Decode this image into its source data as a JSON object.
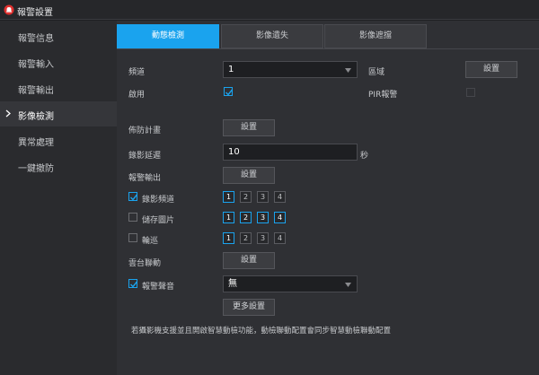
{
  "window": {
    "title": "報警設置",
    "accent": "#1aa3ee",
    "icon": "alarm-bell-icon"
  },
  "sidebar": {
    "items": [
      {
        "label": "報警信息",
        "active": false
      },
      {
        "label": "報警輸入",
        "active": false
      },
      {
        "label": "報警輸出",
        "active": false
      },
      {
        "label": "影像檢測",
        "active": true
      },
      {
        "label": "異常處理",
        "active": false
      },
      {
        "label": "一鍵撤防",
        "active": false
      }
    ]
  },
  "tabs": [
    {
      "label": "動態檢測",
      "active": true
    },
    {
      "label": "影像遺失",
      "active": false
    },
    {
      "label": "影像遮擋",
      "active": false
    }
  ],
  "form": {
    "channel_label": "頻道",
    "channel_value": "1",
    "region_label": "區域",
    "region_button": "設置",
    "enable_label": "啟用",
    "enable_checked": true,
    "pir_label": "PIR報警",
    "pir_checked": false,
    "schedule_label": "佈防計畫",
    "schedule_button": "設置",
    "delay_label": "錄影延遲",
    "delay_value": "10",
    "delay_unit": "秒",
    "alarm_out_label": "報警輸出",
    "alarm_out_button": "設置",
    "record_label": "錄影頻道",
    "record_checked": true,
    "record_channels": [
      "1",
      "2",
      "3",
      "4"
    ],
    "snapshot_label": "儲存圖片",
    "snapshot_checked": false,
    "snapshot_channels": [
      "1",
      "2",
      "3",
      "4"
    ],
    "tour_label": "輪巡",
    "tour_checked": false,
    "tour_channels": [
      "1",
      "2",
      "3",
      "4"
    ],
    "ptz_label": "雲台聯動",
    "ptz_button": "設置",
    "sound_label": "報警聲音",
    "sound_checked": true,
    "sound_value": "無",
    "more_button": "更多設置",
    "note": "若攝影機支援並且開啟智慧動檢功能，動檢聯動配置會同步智慧動檢聯動配置"
  }
}
